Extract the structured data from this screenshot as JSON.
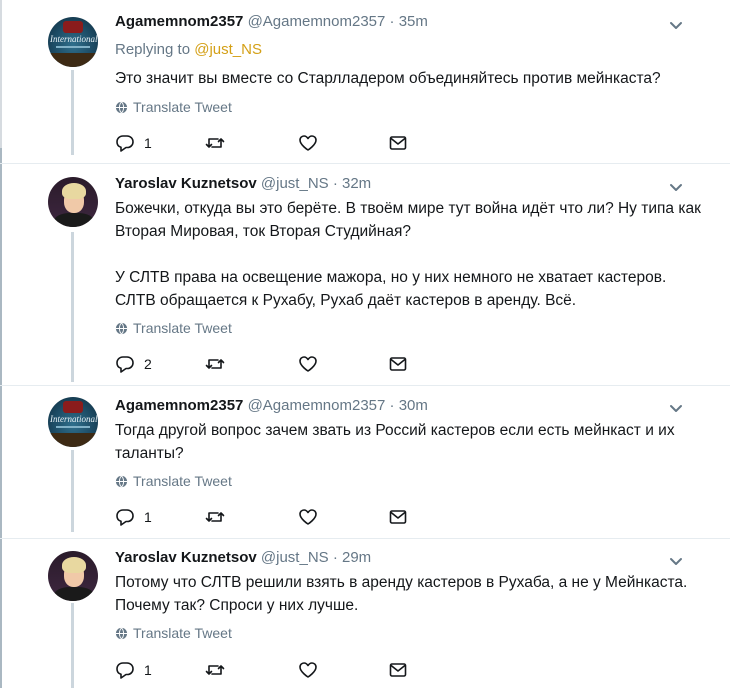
{
  "translate_label": "Translate Tweet",
  "tweets": [
    {
      "name": "Agamemnom2357",
      "handle": "@Agamemnom2357",
      "dot": "·",
      "time": "35m",
      "replying_to": "Replying to",
      "replying_mention": "@just_NS",
      "paragraphs": [
        "Это значит вы вместе со Старлладером объединяйтесь против мейнкаста?"
      ],
      "avatar": "The International avatar",
      "avatar_text": "International",
      "reply_count": "1"
    },
    {
      "name": "Yaroslav Kuznetsov",
      "handle": "@just_NS",
      "dot": "·",
      "time": "32m",
      "paragraphs": [
        "Божечки, откуда вы это берёте. В твоём мире тут война идёт что ли? Ну типа как Вторая Мировая, ток Вторая Студийная?",
        "У СЛТВ права на освещение мажора, но у них немного не хватает кастеров. СЛТВ обращается к Рухабу, Рухаб даёт кастеров в аренду. Всё."
      ],
      "avatar": "profile photo",
      "reply_count": "2"
    },
    {
      "name": "Agamemnom2357",
      "handle": "@Agamemnom2357",
      "dot": "·",
      "time": "30m",
      "paragraphs": [
        "Тогда другой вопрос зачем звать из Россий кастеров если есть мейнкаст и их таланты?"
      ],
      "avatar": "The International avatar",
      "avatar_text": "International",
      "reply_count": "1"
    },
    {
      "name": "Yaroslav Kuznetsov",
      "handle": "@just_NS",
      "dot": "·",
      "time": "29m",
      "paragraphs": [
        "Потому что СЛТВ решили взять в аренду кастеров в Рухаба, а не у Мейнкаста. Почему так? Спроси у них лучше."
      ],
      "avatar": "profile photo",
      "reply_count": "1"
    }
  ],
  "icons": [
    "reply-icon",
    "retweet-icon",
    "like-icon",
    "message-icon",
    "globe-icon",
    "chevron-down-icon"
  ],
  "colors": {
    "mention": "#d4a017",
    "muted": "#657786",
    "thread": "#ccd6dd",
    "separator": "#e6ecf0"
  }
}
